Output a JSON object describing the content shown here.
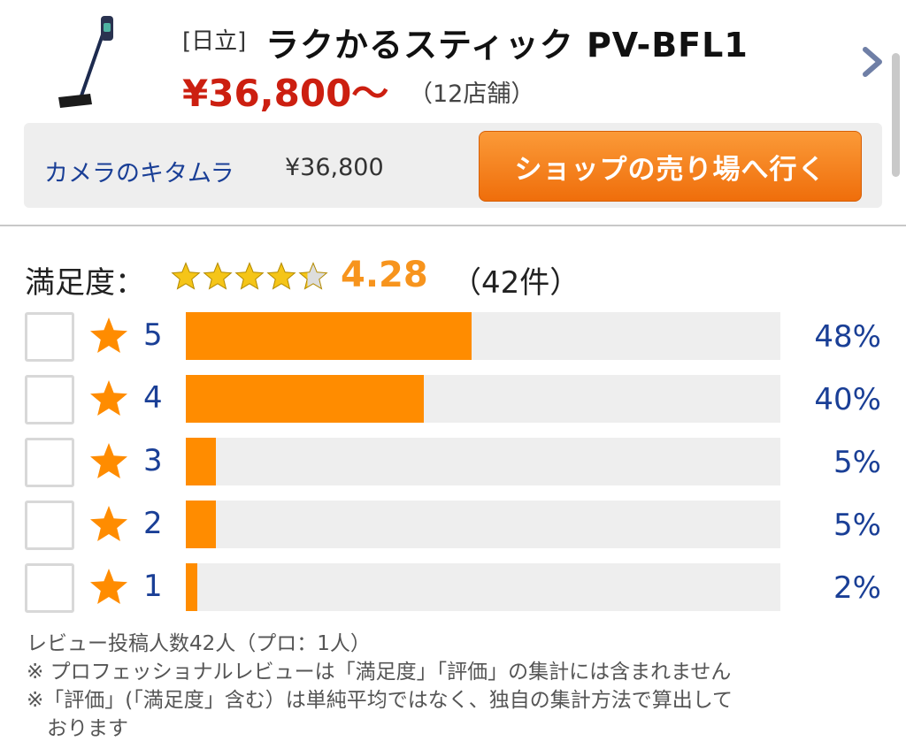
{
  "product": {
    "maker": "[日立]",
    "name": "ラクかるスティック PV-BFL1",
    "price": "¥36,800〜",
    "shops_count": "（12店舗）"
  },
  "shop": {
    "name": "カメラのキタムラ",
    "price": "¥36,800",
    "button_label": "ショップの売り場へ行く"
  },
  "rating": {
    "label": "満足度：",
    "score": "4.28",
    "count": "（42件）",
    "stars_value": 4.28,
    "rows": [
      {
        "stars": "5",
        "percent": "48%",
        "value": 48
      },
      {
        "stars": "4",
        "percent": "40%",
        "value": 40
      },
      {
        "stars": "3",
        "percent": "5%",
        "value": 5
      },
      {
        "stars": "2",
        "percent": "5%",
        "value": 5
      },
      {
        "stars": "1",
        "percent": "2%",
        "value": 2
      }
    ]
  },
  "notes": [
    "レビュー投稿人数42人（プロ：1人）",
    "※ プロフェッショナルレビューは「満足度」「評価」の集計には含まれません",
    "※「評価」(「満足度」含む）は単純平均ではなく、独自の集計方法で算出して",
    "　おります"
  ],
  "colors": {
    "price": "#cc1f10",
    "accent_orange": "#ff8c00",
    "link_blue": "#1a3f96",
    "score": "#f7941d"
  },
  "icons": {
    "product": "stick-vacuum-image",
    "chevron": "chevron-right-icon",
    "star": "star-icon"
  }
}
